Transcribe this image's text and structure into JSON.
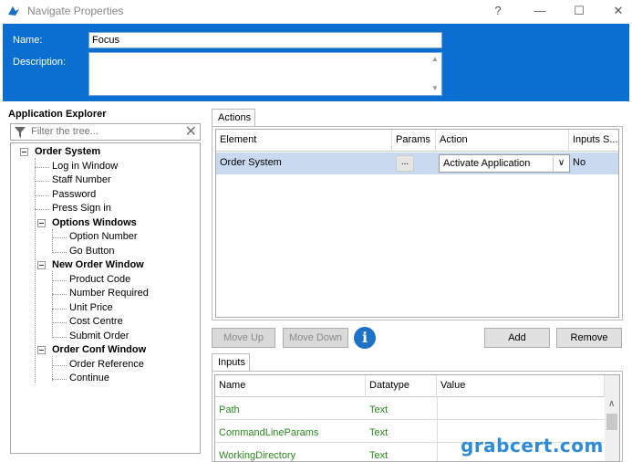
{
  "window": {
    "title": "Navigate Properties",
    "help": "?",
    "minimize": "—",
    "maximize": "☐",
    "close": "✕"
  },
  "header": {
    "name_label": "Name:",
    "name_value": "Focus",
    "description_label": "Description:",
    "description_value": "",
    "scroll_up": "▲",
    "scroll_down": "▼"
  },
  "explorer": {
    "title": "Application Explorer",
    "filter_placeholder": "Filter the tree...",
    "clear": "✕",
    "items": [
      {
        "label": "Order System",
        "bold": true
      },
      {
        "label": "Log in Window"
      },
      {
        "label": "Staff Number"
      },
      {
        "label": "Password"
      },
      {
        "label": "Press Sign in"
      },
      {
        "label": "Options Windows",
        "bold": true
      },
      {
        "label": "Option Number"
      },
      {
        "label": "Go Button"
      },
      {
        "label": "New Order Window",
        "bold": true
      },
      {
        "label": "Product Code"
      },
      {
        "label": "Number Required"
      },
      {
        "label": "Unit Price"
      },
      {
        "label": "Cost Centre"
      },
      {
        "label": "Submit Order"
      },
      {
        "label": "Order Conf Window",
        "bold": true
      },
      {
        "label": "Order Reference"
      },
      {
        "label": "Continue"
      }
    ]
  },
  "actions": {
    "tab_label": "Actions",
    "columns": [
      "Element",
      "Params",
      "Action",
      "Inputs S..."
    ],
    "row": {
      "element": "Order System",
      "params": "...",
      "action": "Activate Application",
      "inputs": "No"
    },
    "select_arrow": "∨"
  },
  "buttons": {
    "move_up": "Move Up",
    "move_down": "Move Down",
    "info": "i",
    "add": "Add",
    "remove": "Remove"
  },
  "inputs": {
    "tab_label": "Inputs",
    "columns": [
      "Name",
      "Datatype",
      "Value"
    ],
    "rows": [
      {
        "name": "Path",
        "datatype": "Text",
        "value": ""
      },
      {
        "name": "CommandLineParams",
        "datatype": "Text",
        "value": ""
      },
      {
        "name": "WorkingDirectory",
        "datatype": "Text",
        "value": ""
      }
    ],
    "scroll_up": "∧"
  },
  "watermark": "grabcert.com",
  "colors": {
    "header_bg": "#0a6fd1",
    "selected_row": "#c9daf0",
    "input_text": "#2a8a1f",
    "info_icon": "#1c73c8"
  }
}
